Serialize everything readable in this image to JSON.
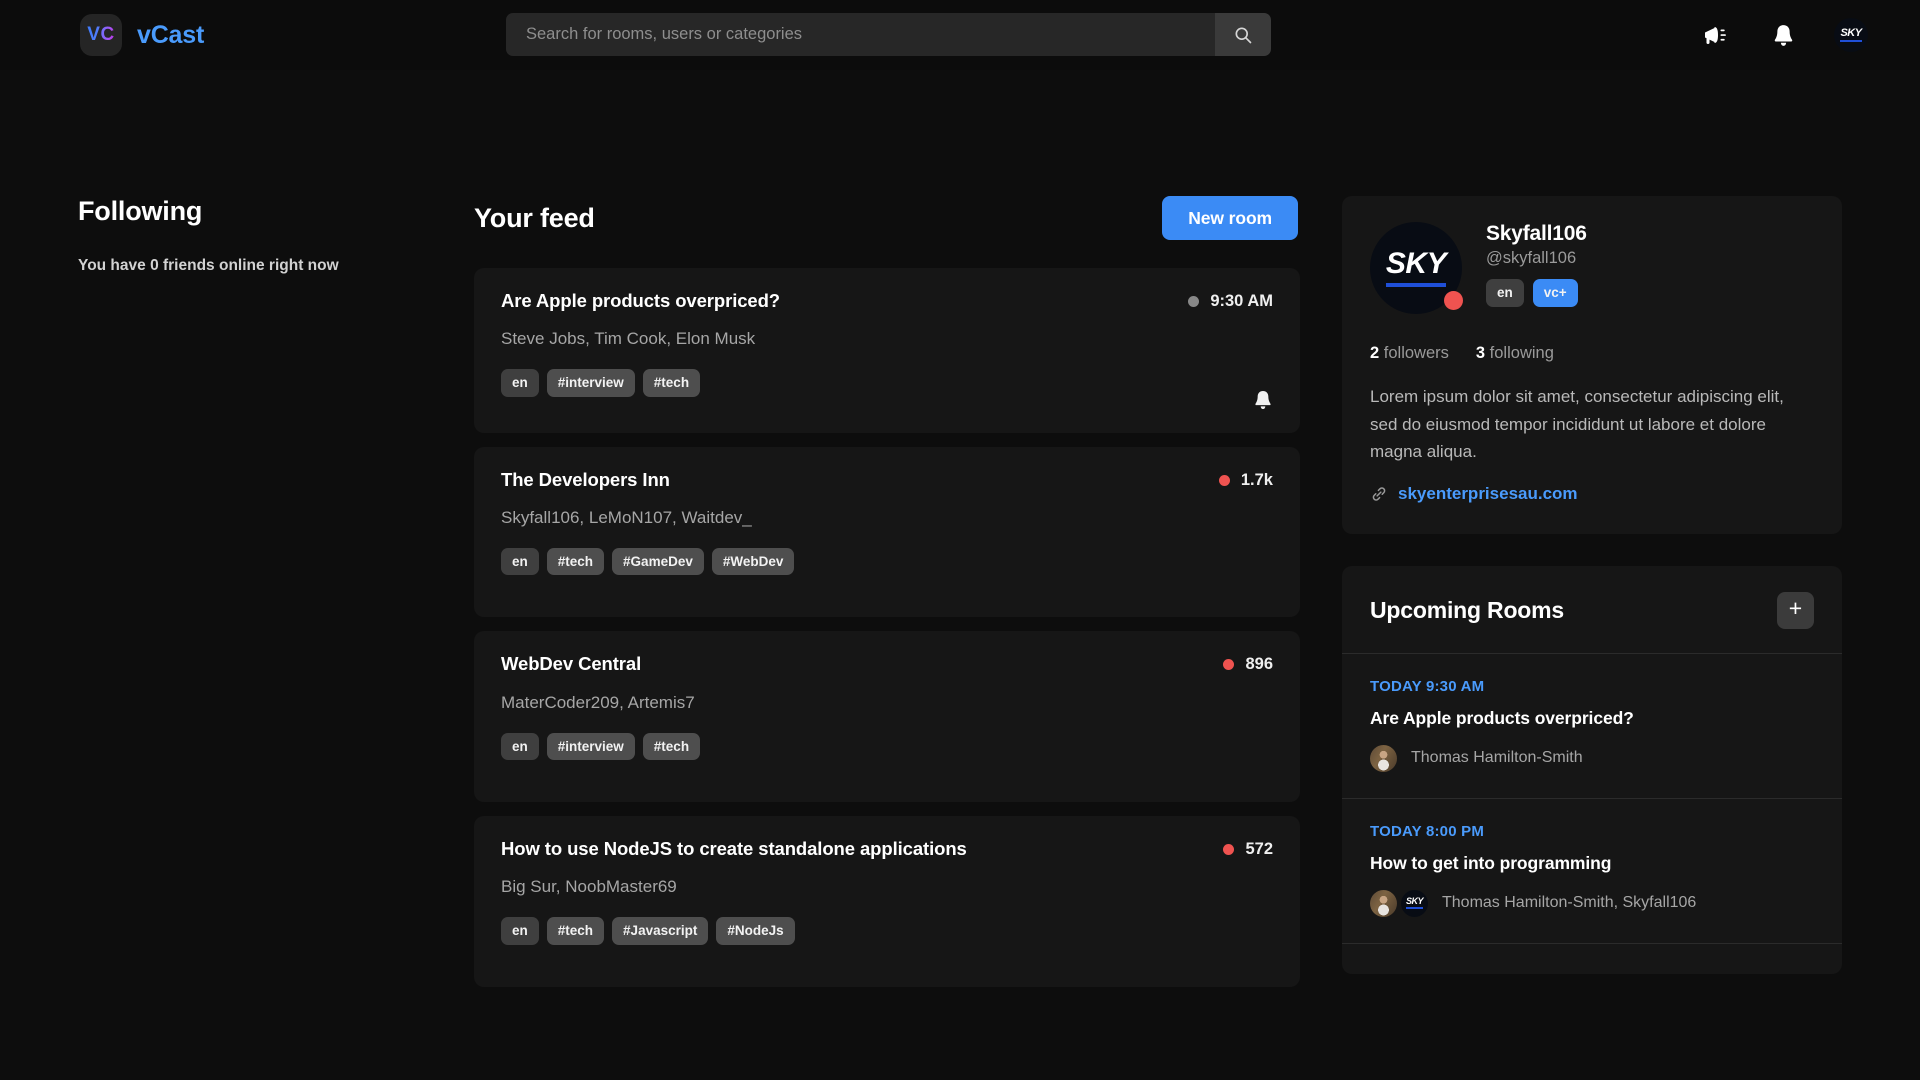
{
  "brand": {
    "logo_text": "VC",
    "name": "vCast",
    "logo_gradient_from": "#3d7bfd",
    "logo_gradient_to": "#c026d3",
    "name_color": "#4a9bfc"
  },
  "search": {
    "placeholder": "Search for rooms, users or categories",
    "value": "",
    "icon": "search-icon",
    "button_icon": "search-icon"
  },
  "topbar": {
    "announcements_icon": "megaphone-icon",
    "notifications_icon": "bell-icon",
    "avatar_text": "SKY"
  },
  "left": {
    "title": "Following",
    "subtitle": "You have 0 friends online right now"
  },
  "feed": {
    "title": "Your feed",
    "new_room_label": "New room",
    "accent_color": "#3b8bf5",
    "rooms": [
      {
        "title": "Are Apple products overpriced?",
        "users": "Steve Jobs, Tim Cook, Elon Musk",
        "status_dot_color": "#888888",
        "count": "9:30 AM",
        "tags": [
          "en",
          "#interview",
          "#tech"
        ],
        "bell_icon": "bell-icon",
        "has_bell": true
      },
      {
        "title": "The Developers Inn",
        "users": "Skyfall106, LeMoN107, Waitdev_",
        "status_dot_color": "#ef5350",
        "count": "1.7k",
        "tags": [
          "en",
          "#tech",
          "#GameDev",
          "#WebDev"
        ],
        "has_bell": false
      },
      {
        "title": "WebDev Central",
        "users": "MaterCoder209, Artemis7",
        "status_dot_color": "#ef5350",
        "count": "896",
        "tags": [
          "en",
          "#interview",
          "#tech"
        ],
        "has_bell": false
      },
      {
        "title": "How to use NodeJS to create standalone applications",
        "users": "Big Sur, NoobMaster69",
        "status_dot_color": "#ef5350",
        "count": "572",
        "tags": [
          "en",
          "#tech",
          "#Javascript",
          "#NodeJs"
        ],
        "has_bell": false
      }
    ]
  },
  "profile": {
    "avatar_text": "SKY",
    "status": "busy",
    "status_color": "#ef5350",
    "name": "Skyfall106",
    "handle": "@skyfall106",
    "tags": [
      {
        "label": "en",
        "kind": "lang"
      },
      {
        "label": "vc+",
        "kind": "premium"
      }
    ],
    "followers_count": "2",
    "followers_label": "followers",
    "following_count": "3",
    "following_label": "following",
    "bio": "Lorem ipsum dolor sit amet, consectetur adipiscing elit, sed do eiusmod tempor incididunt ut labore et dolore magna aliqua.",
    "link_icon": "link-icon",
    "link_text": "skyenterprisesau.com"
  },
  "upcoming": {
    "title": "Upcoming Rooms",
    "add_label": "+",
    "add_icon": "plus-icon",
    "items": [
      {
        "time": "TODAY 9:30 AM",
        "title": "Are Apple products overpriced?",
        "hosts": "Thomas Hamilton-Smith",
        "avatars": [
          "photo",
          null
        ]
      },
      {
        "time": "TODAY 8:00 PM",
        "title": "How to get into programming",
        "hosts": "Thomas Hamilton-Smith, Skyfall106",
        "avatars": [
          "photo",
          "SKY"
        ]
      }
    ]
  }
}
